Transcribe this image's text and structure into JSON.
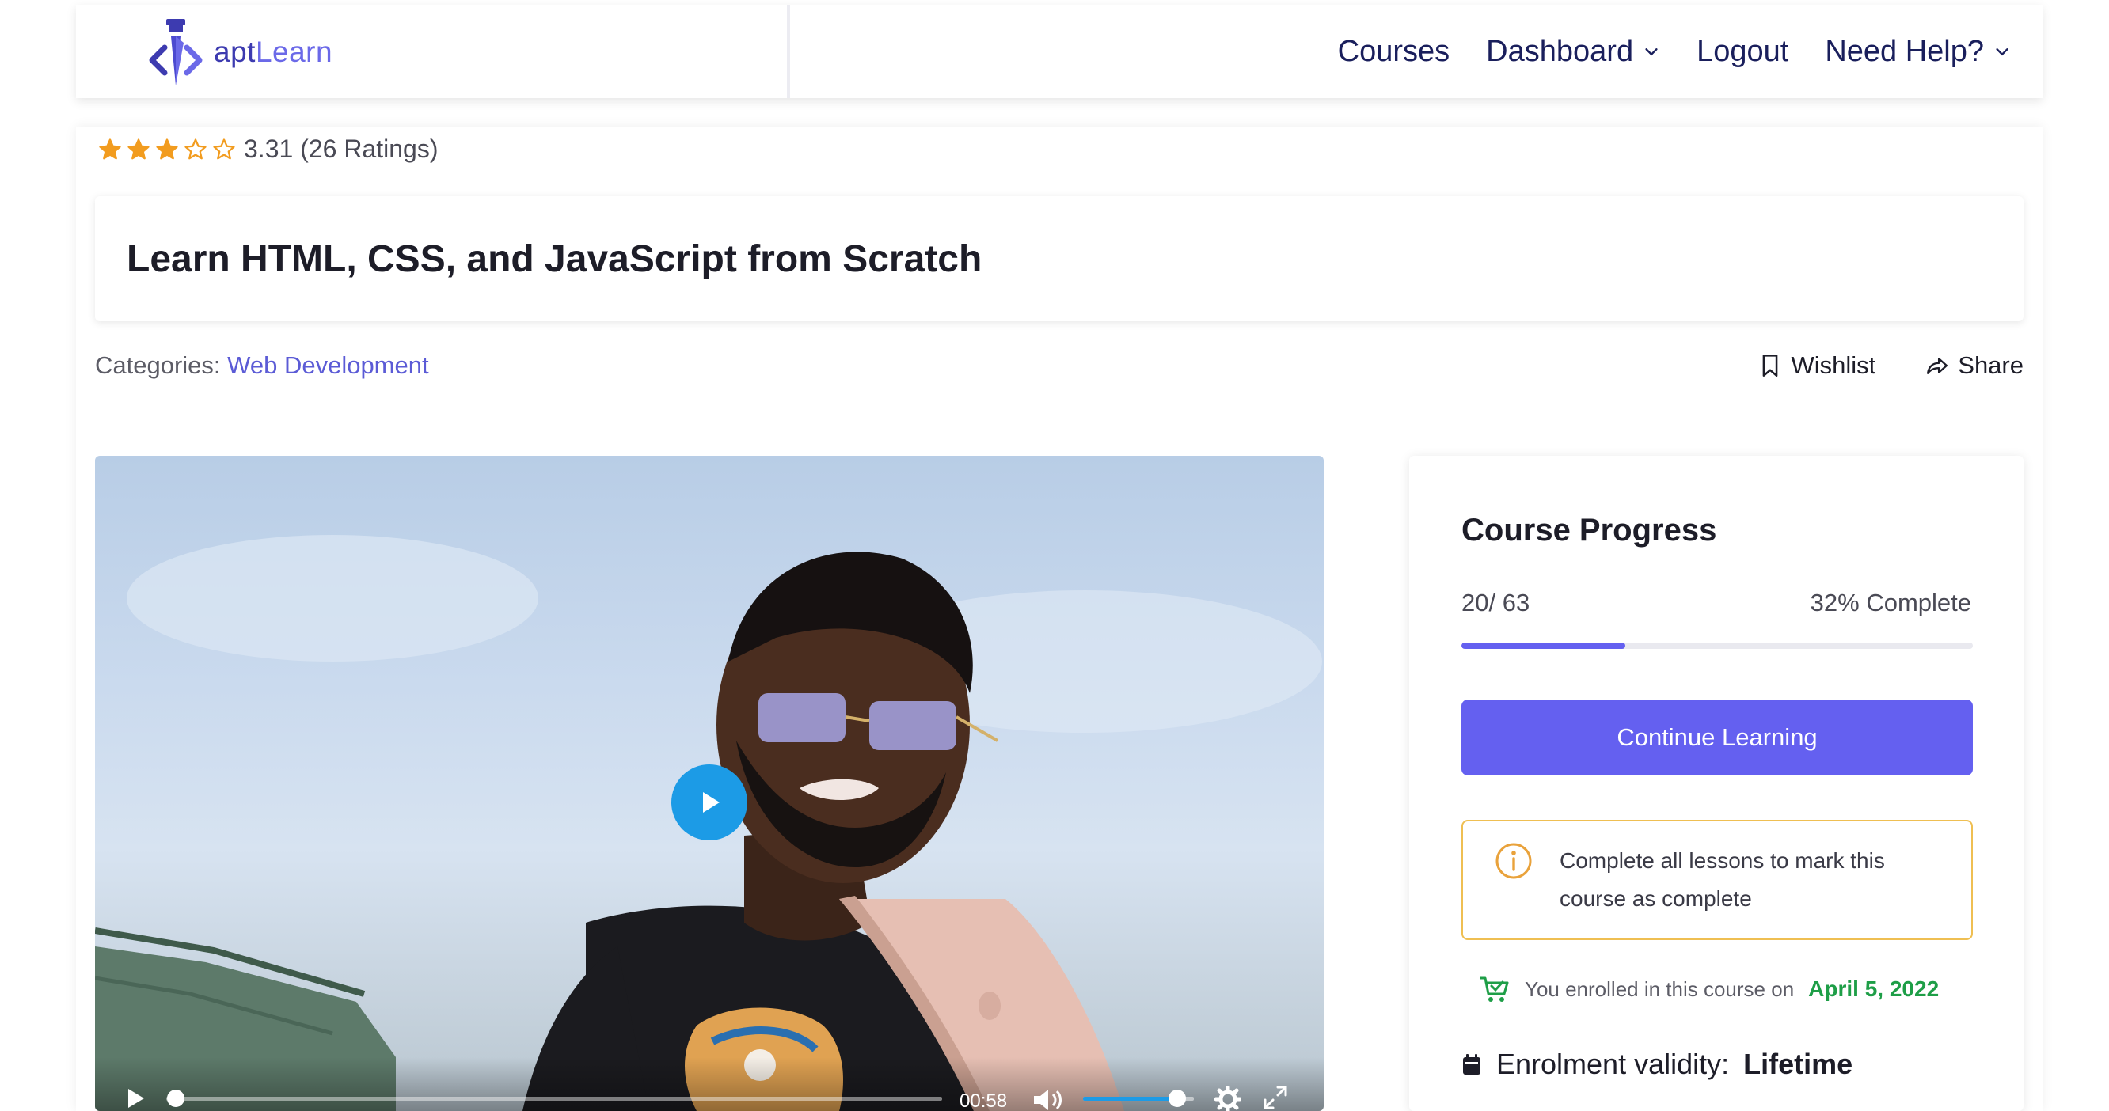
{
  "header": {
    "logo": {
      "apt": "apt",
      "learn": "Learn"
    },
    "nav": [
      {
        "label": "Courses",
        "has_dropdown": false
      },
      {
        "label": "Dashboard",
        "has_dropdown": true
      },
      {
        "label": "Logout",
        "has_dropdown": false
      },
      {
        "label": "Need Help?",
        "has_dropdown": true
      }
    ]
  },
  "course": {
    "rating": {
      "stars_filled": 3,
      "stars_total": 5,
      "text": "3.31 (26 Ratings)"
    },
    "title": "Learn HTML, CSS, and JavaScript from Scratch",
    "categories_label": "Categories:",
    "category": "Web Development",
    "actions": {
      "wishlist": "Wishlist",
      "share": "Share"
    }
  },
  "video": {
    "time": "00:58",
    "played_fraction": 0.0,
    "volume_fraction": 0.85
  },
  "progress": {
    "title": "Course Progress",
    "count": "20/ 63",
    "percent_text": "32% Complete",
    "percent": 0.32,
    "button": "Continue Learning",
    "notice": "Complete all lessons to mark this course as complete",
    "enrolled_text": "You enrolled in this course on",
    "enrolled_date": "April 5, 2022",
    "validity_label": "Enrolment validity:",
    "validity_value": "Lifetime"
  },
  "colors": {
    "accent": "#6460f0",
    "star": "#f29c1f",
    "link": "#5b5bd6",
    "success": "#1e9e47",
    "warning": "#efbf52",
    "nav_text": "#1a1f5c",
    "play": "#1c9be6"
  }
}
